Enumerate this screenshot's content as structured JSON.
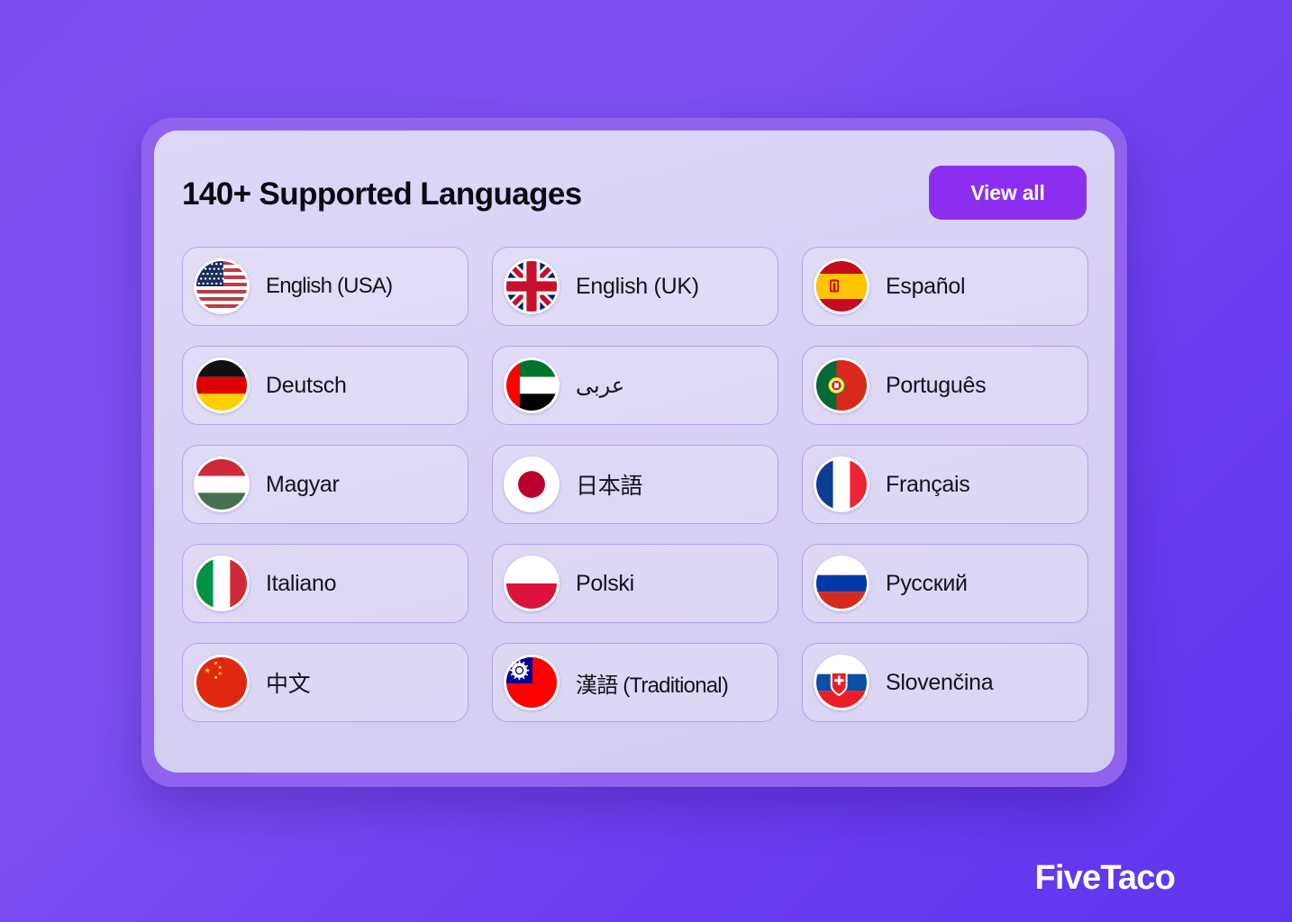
{
  "header": {
    "title": "140+ Supported Languages",
    "view_all_label": "View all"
  },
  "brand": {
    "watermark": "FiveTaco"
  },
  "colors": {
    "background_purple": "#7b4df0",
    "card_frame": "#8f63f0",
    "card_surface": "#ded8f7",
    "accent_button": "#8b2ef0",
    "text_dark": "#0a0a14",
    "cell_border": "#7d5ac8"
  },
  "languages": [
    {
      "label": "English (USA)",
      "flag": "flag-us",
      "name": "language-english-usa"
    },
    {
      "label": "English (UK)",
      "flag": "flag-gb",
      "name": "language-english-uk"
    },
    {
      "label": "Español",
      "flag": "flag-es",
      "name": "language-espanol"
    },
    {
      "label": "Deutsch",
      "flag": "flag-de",
      "name": "language-deutsch"
    },
    {
      "label": "عربى",
      "flag": "flag-ae",
      "name": "language-arabic"
    },
    {
      "label": "Português",
      "flag": "flag-pt",
      "name": "language-portugues"
    },
    {
      "label": "Magyar",
      "flag": "flag-hu",
      "name": "language-magyar"
    },
    {
      "label": "日本語",
      "flag": "flag-jp",
      "name": "language-japanese"
    },
    {
      "label": "Français",
      "flag": "flag-fr",
      "name": "language-francais"
    },
    {
      "label": "Italiano",
      "flag": "flag-it",
      "name": "language-italiano"
    },
    {
      "label": "Polski",
      "flag": "flag-pl",
      "name": "language-polski"
    },
    {
      "label": "Русский",
      "flag": "flag-ru",
      "name": "language-russian"
    },
    {
      "label": "中文",
      "flag": "flag-cn",
      "name": "language-chinese"
    },
    {
      "label": "漢語 (Traditional)",
      "flag": "flag-tw",
      "name": "language-chinese-traditional"
    },
    {
      "label": "Slovenčina",
      "flag": "flag-sk",
      "name": "language-slovencina"
    }
  ]
}
